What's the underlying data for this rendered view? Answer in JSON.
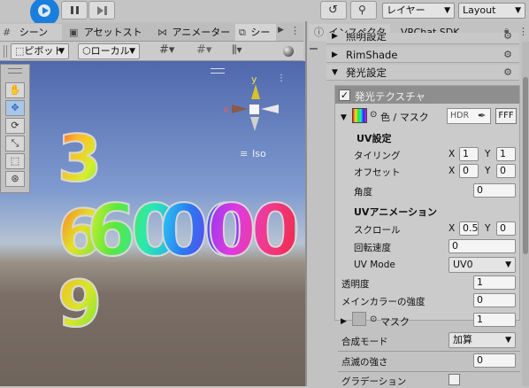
{
  "toolbar": {
    "layers_label": "レイヤー",
    "layout_label": "Layout"
  },
  "tabs": {
    "scene": "シーン",
    "asset_store": "アセットストア",
    "animator": "アニメーター",
    "game": "シー",
    "inspector": "インスペクター",
    "vrchat_sdk": "VRChat SDK"
  },
  "scene_toolbar": {
    "pivot": "ピボット",
    "local": "ローカル",
    "num": "#"
  },
  "gizmo": {
    "x": "x",
    "y": "y",
    "iso": "Iso"
  },
  "scene_numbers": [
    "3",
    "6",
    "9",
    "60",
    "00",
    "00"
  ],
  "inspector": {
    "sections": {
      "top_partial": "照明設定",
      "rimshade": "RimShade",
      "emission": "発光設定"
    },
    "emission_texture": {
      "title": "発光テクスチャ",
      "color_mask_label": "色 / マスク",
      "hdr": "HDR",
      "fff": "FFF",
      "uv_settings": "UV設定",
      "tiling": "タイリング",
      "tiling_x": "1",
      "tiling_y": "1",
      "offset": "オフセット",
      "offset_x": "0",
      "offset_y": "0",
      "angle": "角度",
      "angle_value": "0",
      "uv_animation": "UVアニメーション",
      "scroll": "スクロール",
      "scroll_x": "0.5",
      "scroll_y": "0",
      "rotation_speed": "回転速度",
      "rotation_value": "0",
      "uv_mode": "UV Mode",
      "uv_mode_value": "UV0",
      "axis_x": "X",
      "axis_y": "Y"
    },
    "transparency": "透明度",
    "transparency_value": "1",
    "main_color_strength": "メインカラーの強度",
    "main_color_strength_value": "0",
    "mask": "マスク",
    "mask_value": "1",
    "blend_mode": "合成モード",
    "blend_mode_value": "加算",
    "blink_strength": "点滅の強さ",
    "blink_value": "0",
    "gradation": "グラデーション"
  },
  "colors": {
    "play_highlight": "#1a7fdc",
    "sky_top": "#5c74b4",
    "ground": "#7a6e66"
  }
}
